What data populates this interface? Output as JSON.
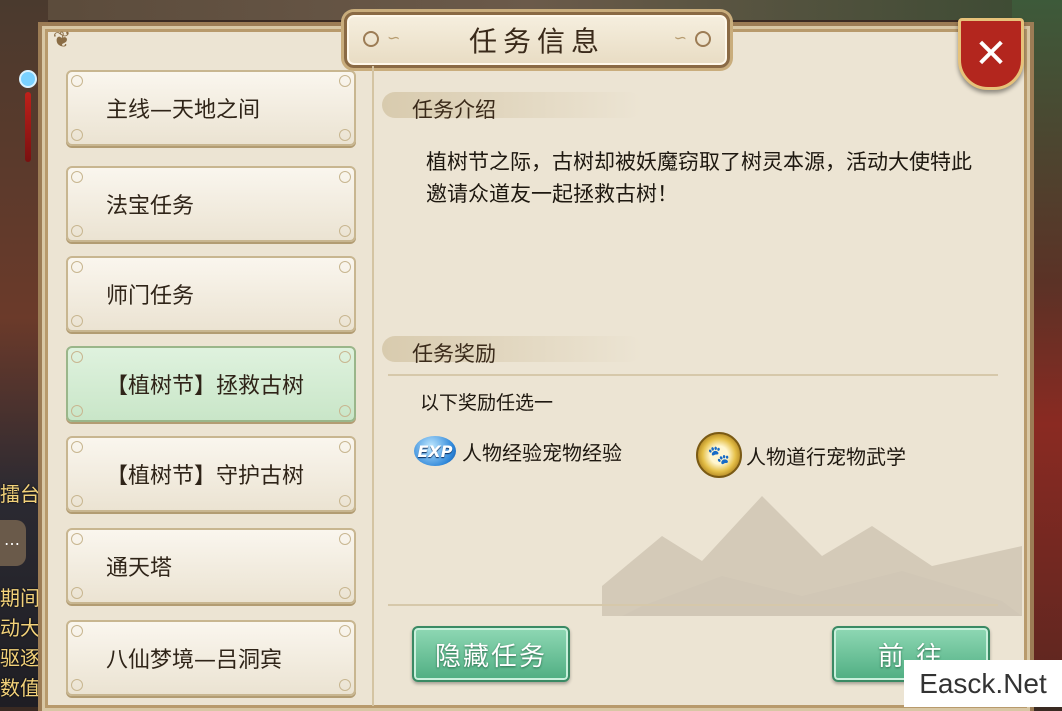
{
  "background": {
    "side_texts": [
      "擂台",
      "期间",
      "动大",
      "驱逐",
      "数值"
    ]
  },
  "dialog": {
    "title": "任务信息",
    "close_label": "✕"
  },
  "task_list": [
    {
      "label": "主线—天地之间",
      "active": false
    },
    {
      "label": "法宝任务",
      "active": false
    },
    {
      "label": "师门任务",
      "active": false
    },
    {
      "label": "【植树节】拯救古树",
      "active": true
    },
    {
      "label": "【植树节】守护古树",
      "active": false
    },
    {
      "label": "通天塔",
      "active": false
    },
    {
      "label": "八仙梦境—吕洞宾",
      "active": false
    }
  ],
  "detail": {
    "intro_heading": "任务介绍",
    "intro_text": "植树节之际，古树却被妖魔窃取了树灵本源，活动大使特此邀请众道友一起拯救古树！",
    "reward_heading": "任务奖励",
    "reward_choose": "以下奖励任选一",
    "rewards": [
      {
        "icon": "exp-icon",
        "icon_text": "EXP",
        "label": "人物经验宠物经验"
      },
      {
        "icon": "paw-coin-icon",
        "icon_text": "🐾",
        "label": "人物道行宠物武学"
      }
    ]
  },
  "buttons": {
    "hide": "隐藏任务",
    "go": "前 往"
  },
  "watermark": "Easck.Net",
  "colors": {
    "frame": "#9c7c55",
    "panel": "#ece4d3",
    "active_item": "#c9e6c8",
    "button": "#4fae82",
    "close": "#b3261e"
  }
}
